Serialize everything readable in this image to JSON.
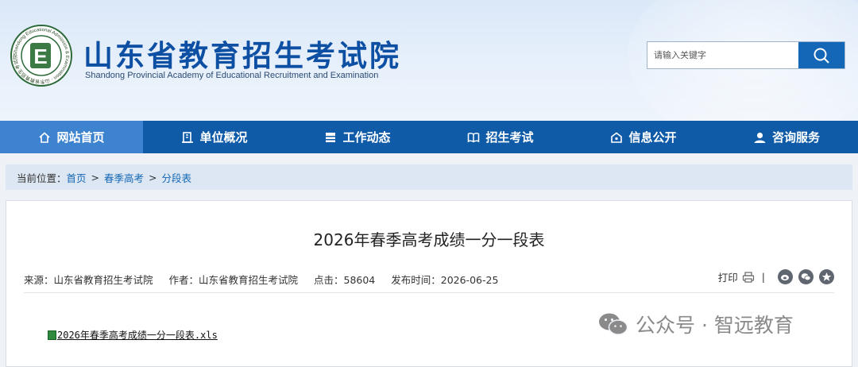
{
  "header": {
    "title_cn": "山东省教育招生考试院",
    "title_en": "Shandong Provincial Academy of Educational Recruitment and Examination",
    "logo_letter": "E",
    "logo_ring_text": "Shandong Educational Admission & Examination · 山东省教育招生考试院"
  },
  "search": {
    "placeholder": "请输入关键字",
    "icon": "search-icon"
  },
  "nav": {
    "items": [
      {
        "label": "网站首页",
        "icon": "home-icon",
        "active": true
      },
      {
        "label": "单位概况",
        "icon": "building-icon"
      },
      {
        "label": "工作动态",
        "icon": "news-icon"
      },
      {
        "label": "招生考试",
        "icon": "book-icon"
      },
      {
        "label": "信息公开",
        "icon": "info-icon"
      },
      {
        "label": "咨询服务",
        "icon": "user-icon"
      }
    ]
  },
  "breadcrumb": {
    "prefix": "当前位置：",
    "items": [
      "首页",
      "春季高考",
      "分段表"
    ],
    "separator": ">"
  },
  "article": {
    "title": "2026年春季高考成绩一分一段表",
    "meta": {
      "source": "来源：山东省教育招生考试院",
      "author": "作者：山东省教育招生考试院",
      "clicks": "点击：58604",
      "published": "发布时间：2026-06-25"
    },
    "print_label": "打印",
    "divider": "|",
    "attachment": "2026年春季高考成绩一分一段表.xls"
  },
  "watermark": {
    "text": "公众号 · 智远教育",
    "icon": "wechat-icon"
  },
  "colors": {
    "brand": "#0d4fa3",
    "nav_bg": "#0f5ba8",
    "nav_active": "#3d83cf",
    "search_btn": "#1467b6"
  }
}
